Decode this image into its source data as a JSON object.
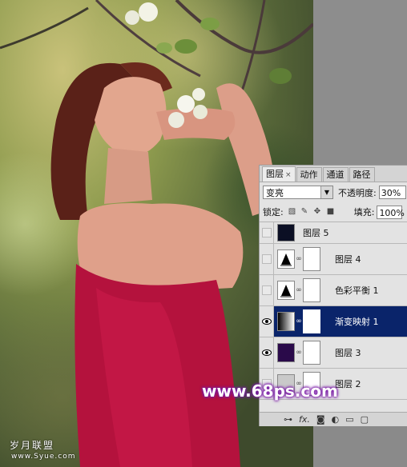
{
  "panel": {
    "tabs": [
      {
        "label": "图层",
        "close": "×"
      },
      {
        "label": "动作"
      },
      {
        "label": "通道"
      },
      {
        "label": "路径"
      }
    ],
    "blend_mode": "变亮",
    "opacity_label": "不透明度:",
    "opacity_value": "30%",
    "lock_label": "锁定:",
    "fill_label": "填充:",
    "fill_value": "100%",
    "layers": [
      {
        "name": "图层 5",
        "visible": false,
        "selected": false
      },
      {
        "name": "图层 4",
        "visible": false,
        "selected": false
      },
      {
        "name": "色彩平衡 1",
        "visible": false,
        "selected": false
      },
      {
        "name": "渐变映射 1",
        "visible": true,
        "selected": true
      },
      {
        "name": "图层 3",
        "visible": true,
        "selected": false
      },
      {
        "name": "图层 2",
        "visible": false,
        "selected": false
      }
    ],
    "bottom_icons": [
      "link-icon",
      "fx-icon",
      "mask-icon",
      "adjustment-icon",
      "folder-icon",
      "new-layer-icon"
    ],
    "bottom_fx": "fx."
  },
  "watermark": "www.68ps.com",
  "logo": {
    "title": "岁月联盟",
    "sub": "www.Syue.com"
  },
  "colors": {
    "selection": "#0a246a",
    "layer5_fill": "#0b0f24",
    "layer3_fill": "#2a0a4a",
    "watermark_glow": "#7a1aa6"
  }
}
